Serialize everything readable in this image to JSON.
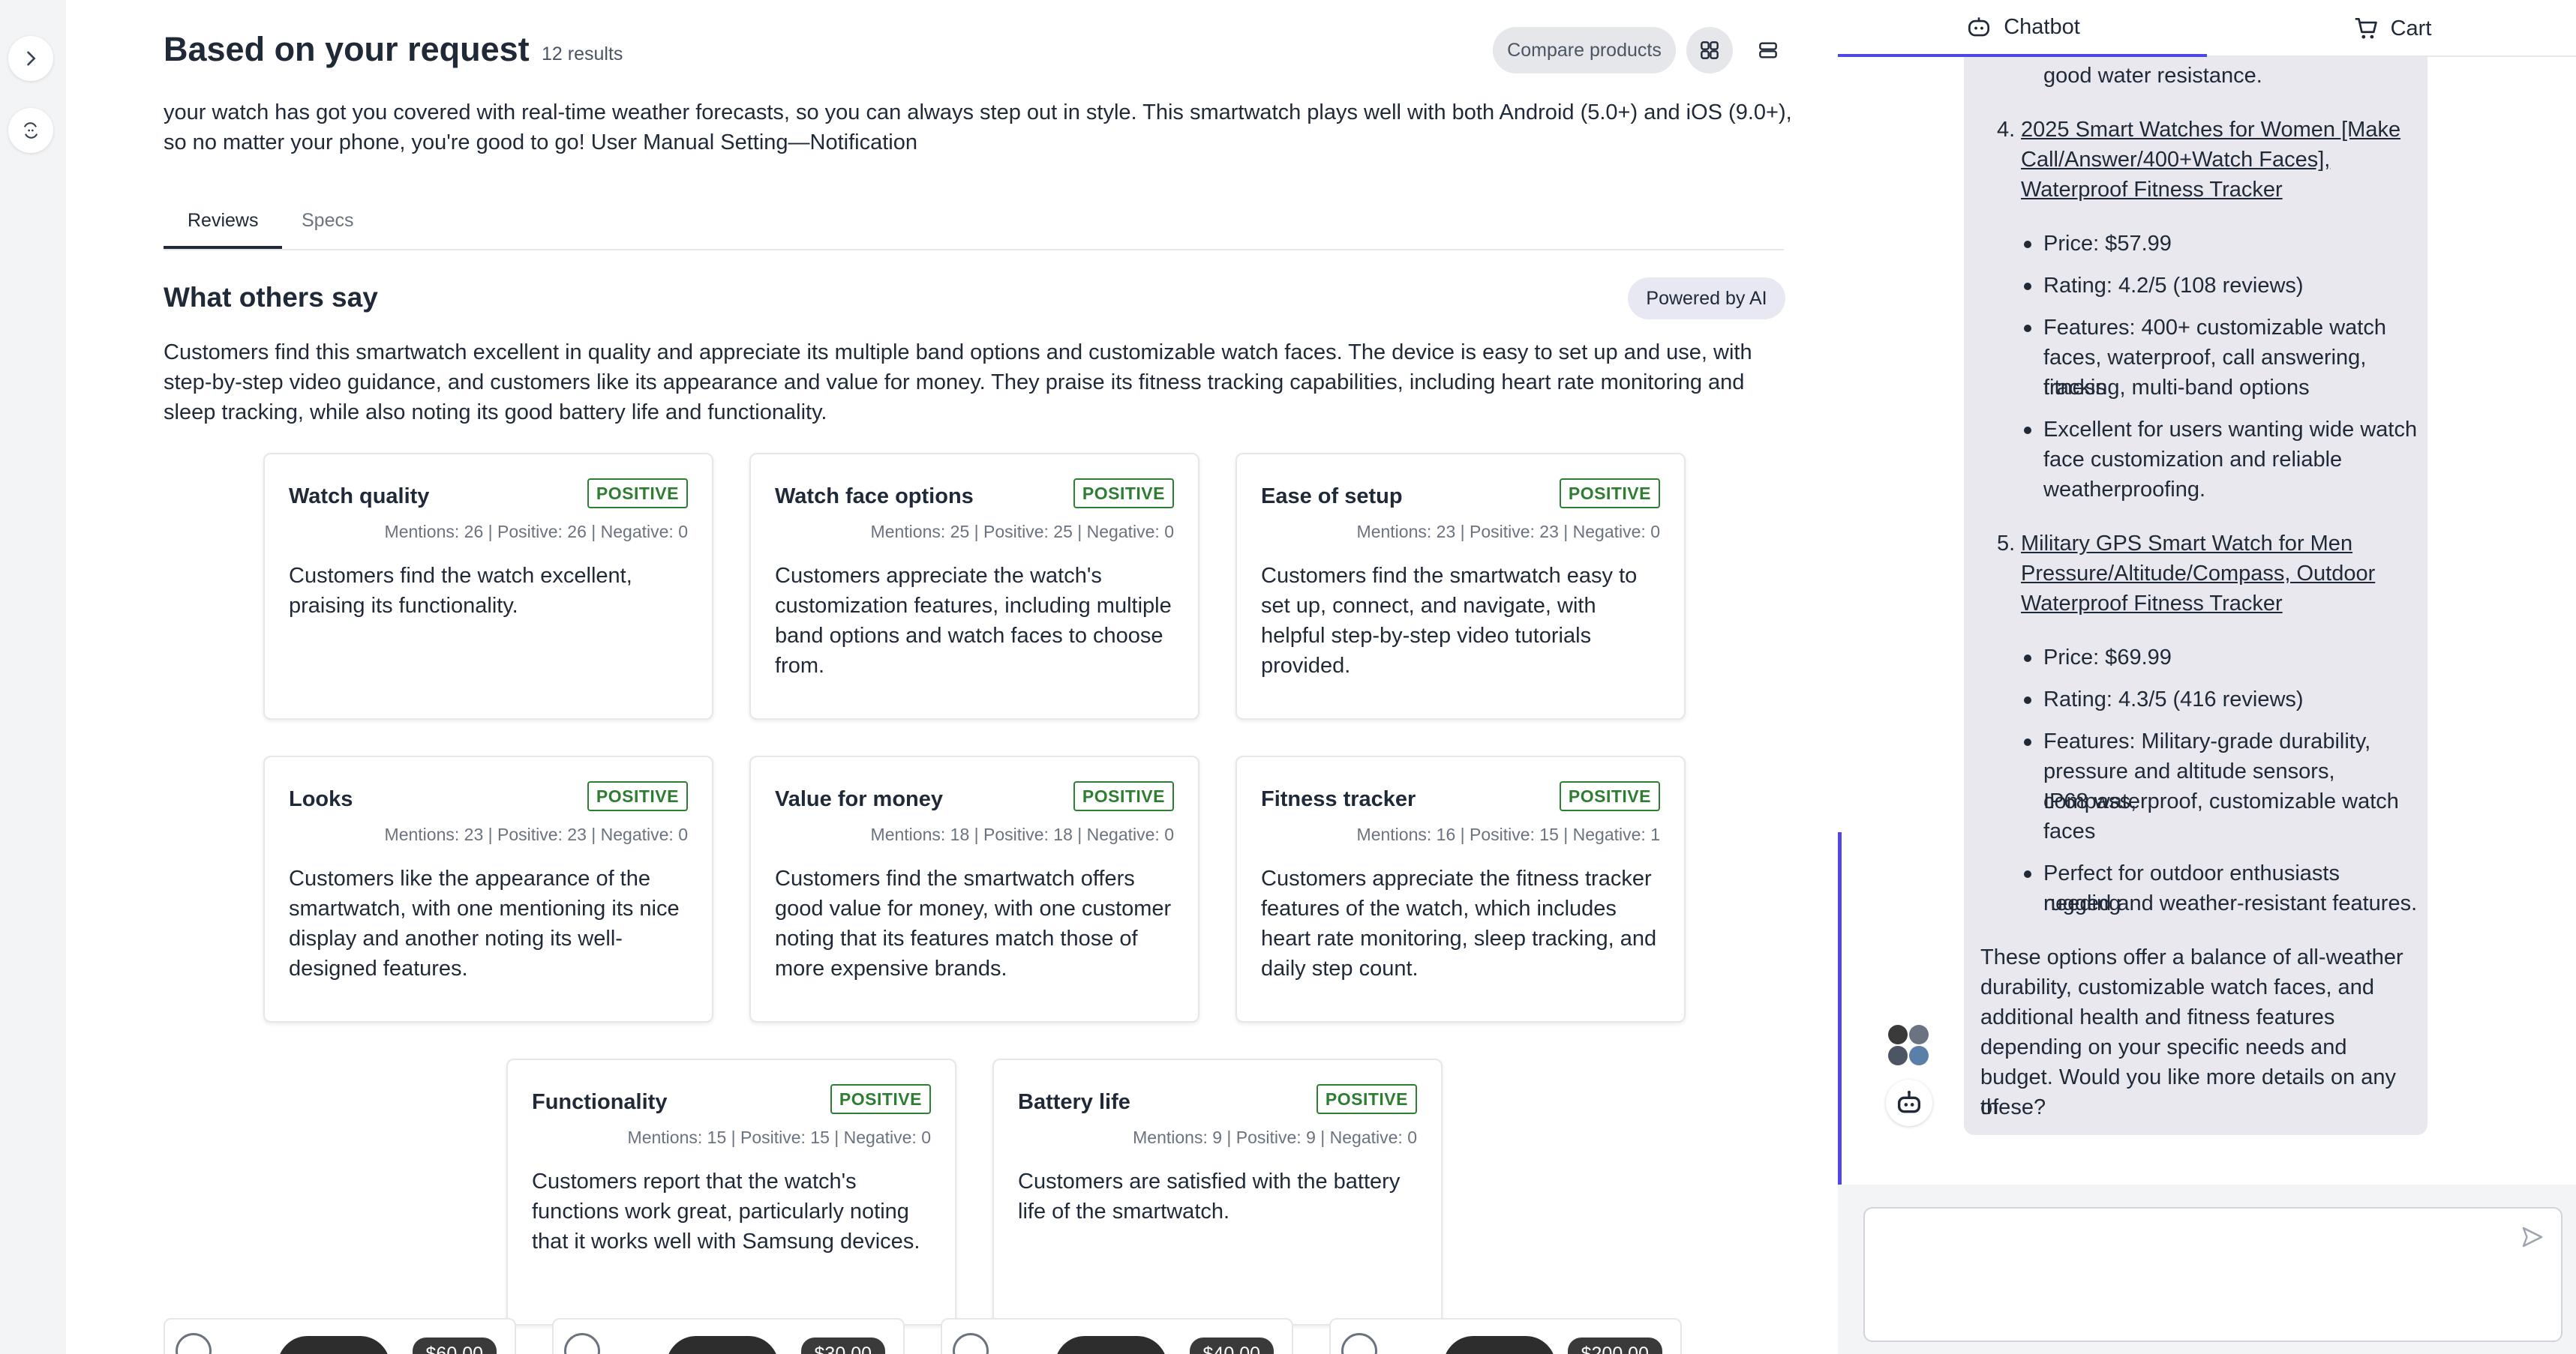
{
  "header": {
    "title": "Based on your request",
    "results_count": "12 results",
    "compare_label": "Compare products"
  },
  "description": "your watch has got you covered with real-time weather forecasts, so you can always step out in style. This smartwatch plays well with both Android (5.0+) and iOS (9.0+), so no matter your phone, you're good to go! User Manual Setting—Notification",
  "tabs": [
    {
      "label": "Reviews",
      "active": true
    },
    {
      "label": "Specs",
      "active": false
    }
  ],
  "reviews": {
    "title": "What others say",
    "powered_label": "Powered by AI",
    "summary": "Customers find this smartwatch excellent in quality and appreciate its multiple band options and customizable watch faces. The device is easy to set up and use, with step-by-step video guidance, and customers like its appearance and value for money. They praise its fitness tracking capabilities, including heart rate monitoring and sleep tracking, while also noting its good battery life and functionality.",
    "cards": [
      {
        "title": "Watch quality",
        "badge": "POSITIVE",
        "stats": "Mentions: 26 | Positive: 26 | Negative: 0",
        "text": "Customers find the watch excellent, praising its functionality."
      },
      {
        "title": "Watch face options",
        "badge": "POSITIVE",
        "stats": "Mentions: 25 | Positive: 25 | Negative: 0",
        "text": "Customers appreciate the watch's customization features, including multiple band options and watch faces to choose from."
      },
      {
        "title": "Ease of setup",
        "badge": "POSITIVE",
        "stats": "Mentions: 23 | Positive: 23 | Negative: 0",
        "text": "Customers find the smartwatch easy to set up, connect, and navigate, with helpful step-by-step video tutorials provided."
      },
      {
        "title": "Looks",
        "badge": "POSITIVE",
        "stats": "Mentions: 23 | Positive: 23 | Negative: 0",
        "text": "Customers like the appearance of the smartwatch, with one mentioning its nice display and another noting its well-designed features."
      },
      {
        "title": "Value for money",
        "badge": "POSITIVE",
        "stats": "Mentions: 18 | Positive: 18 | Negative: 0",
        "text": "Customers find the smartwatch offers good value for money, with one customer noting that its features match those of more expensive brands."
      },
      {
        "title": "Fitness tracker",
        "badge": "POSITIVE",
        "stats": "Mentions: 16 | Positive: 15 | Negative: 1",
        "text": "Customers appreciate the fitness tracker features of the watch, which includes heart rate monitoring, sleep tracking, and daily step count."
      },
      {
        "title": "Functionality",
        "badge": "POSITIVE",
        "stats": "Mentions: 15 | Positive: 15 | Negative: 0",
        "text": "Customers report that the watch's functions work great, particularly noting that it works well with Samsung devices."
      },
      {
        "title": "Battery life",
        "badge": "POSITIVE",
        "stats": "Mentions: 9 | Positive: 9 | Negative: 0",
        "text": "Customers are satisfied with the battery life of the smartwatch."
      }
    ]
  },
  "products": [
    {
      "price": "$60.00"
    },
    {
      "price": "$30.00"
    },
    {
      "price": "$40.00"
    },
    {
      "price": "$200.00"
    }
  ],
  "chat": {
    "tabs": [
      {
        "label": "Chatbot",
        "icon": "chatbot-icon",
        "active": true
      },
      {
        "label": "Cart",
        "icon": "cart-icon",
        "active": false
      }
    ],
    "top_fragment": "good water resistance.",
    "items": [
      {
        "number": "4.",
        "title_lines": [
          "2025 Smart Watches for Women [Make",
          "Call/Answer/400+Watch Faces],",
          "Waterproof Fitness Tracker"
        ],
        "bullets": [
          [
            "Price: $57.99"
          ],
          [
            "Rating: 4.2/5 (108 reviews)"
          ],
          [
            "Features: 400+ customizable watch",
            "faces, waterproof, call answering, fitness",
            "tracking, multi-band options"
          ],
          [
            "Excellent for users wanting wide watch",
            "face customization and reliable",
            "weatherproofing."
          ]
        ]
      },
      {
        "number": "5.",
        "title_lines": [
          "Military GPS Smart Watch for Men",
          "Pressure/Altitude/Compass, Outdoor",
          "Waterproof Fitness Tracker"
        ],
        "bullets": [
          [
            "Price: $69.99"
          ],
          [
            "Rating: 4.3/5 (416 reviews)"
          ],
          [
            "Features: Military-grade durability,",
            "pressure and altitude sensors, compass,",
            "IP68 waterproof, customizable watch",
            "faces"
          ],
          [
            "Perfect for outdoor enthusiasts needing",
            "rugged and weather-resistant features."
          ]
        ]
      }
    ],
    "closing_lines": [
      "These options offer a balance of all-weather",
      "durability, customizable watch faces, and",
      "additional health and fitness features",
      "depending on your specific needs and",
      "budget. Would you like more details on any of",
      "these?"
    ],
    "input_placeholder": ""
  },
  "colors": {
    "positive": "#2e7d32",
    "accent": "#4f46e5",
    "bubble": "#e8e8ee"
  }
}
